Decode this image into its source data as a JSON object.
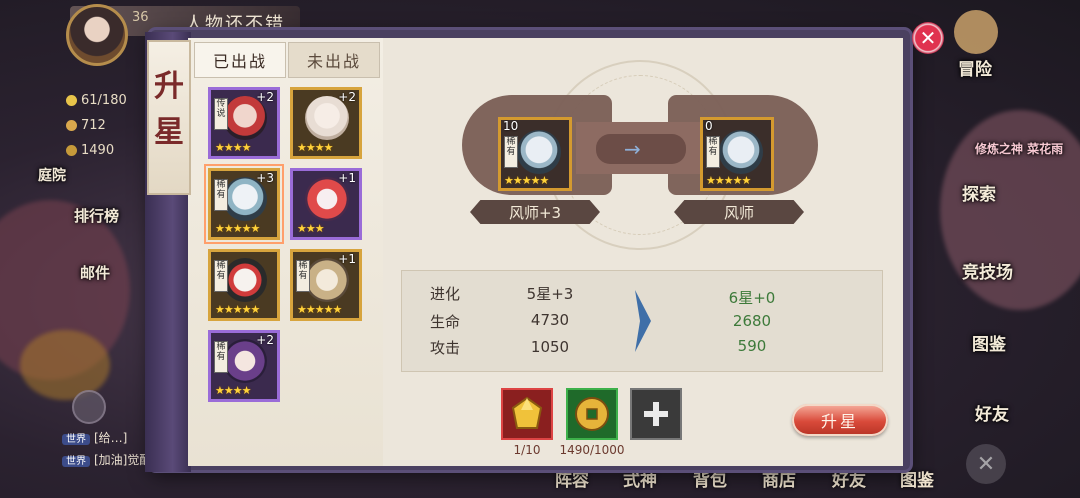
{
  "hud": {
    "level": "36",
    "player_title": "人物还不错",
    "resources": [
      {
        "icon": "stamina-icon",
        "value": "61/180",
        "color": "#e8c44a"
      },
      {
        "icon": "jade-icon",
        "value": "712",
        "color": "#d9a84d"
      },
      {
        "icon": "coin-icon",
        "value": "1490",
        "color": "#c69a3a"
      }
    ],
    "left_side_labels": [
      "庭院",
      "排行榜",
      "邮件"
    ],
    "right_side_labels": [
      "冒险",
      "探索",
      "竞技场",
      "图鉴",
      "好友"
    ],
    "right_notice": "修炼之神 菜花雨",
    "chat": [
      {
        "channel": "世界",
        "text": "[给…]"
      },
      {
        "channel": "世界",
        "text": "[加油]觉醒的鸟神不少灵是谁"
      }
    ],
    "bottom_menu": [
      "阵容",
      "式神",
      "背包",
      "商店",
      "好友",
      "图鉴"
    ]
  },
  "panel": {
    "title": "升星",
    "tabs": {
      "deployed": "已出战",
      "undeployed": "未出战"
    },
    "cards": [
      {
        "plus": "+2",
        "tag": "传说",
        "frame": "purple",
        "face_color": "#c23a3a",
        "stars": "★★★★"
      },
      {
        "plus": "+2",
        "tag": "",
        "frame": "gold",
        "face_color": "#efe6dc",
        "stars": "★★★★"
      },
      {
        "plus": "+3",
        "tag": "稀有",
        "frame": "gold",
        "face_color": "#dde6ec",
        "stars": "★★★★★",
        "selected": true
      },
      {
        "plus": "+1",
        "tag": "",
        "frame": "purple",
        "face_color": "#e04a4a",
        "stars": "★★★"
      },
      {
        "plus": "",
        "tag": "稀有",
        "frame": "gold",
        "face_color": "#f2f0ee",
        "stars": "★★★★★"
      },
      {
        "plus": "+1",
        "tag": "稀有",
        "frame": "gold",
        "face_color": "#e9d7b5",
        "stars": "★★★★★"
      },
      {
        "plus": "+2",
        "tag": "稀有",
        "frame": "purple",
        "face_color": "#6a3f8a",
        "stars": "★★★★"
      }
    ],
    "current": {
      "name": "风师+3",
      "level": "10",
      "tag": "稀有",
      "stars": "★★★★★"
    },
    "result": {
      "name": "风师",
      "level": "0",
      "tag": "稀有",
      "stars": "★★★★★"
    },
    "stats": [
      {
        "label": "进化",
        "current": "5星+3",
        "new": "6星+0"
      },
      {
        "label": "生命",
        "current": "4730",
        "new": "2680"
      },
      {
        "label": "攻击",
        "current": "1050",
        "new": "590"
      }
    ],
    "materials": [
      {
        "icon": "gold-gem-icon",
        "label": "1/10"
      },
      {
        "icon": "gold-coin-icon",
        "label": "1490/1000"
      },
      {
        "icon": "plus-icon",
        "label": ""
      }
    ],
    "upgrade_button": "升星"
  },
  "colors": {
    "accent": "#d94a3a",
    "panel_bg": "#ece6db",
    "stat_new": "#3d7a3a",
    "frame_purple": "#9a6cd8",
    "frame_gold": "#d7a43d"
  }
}
